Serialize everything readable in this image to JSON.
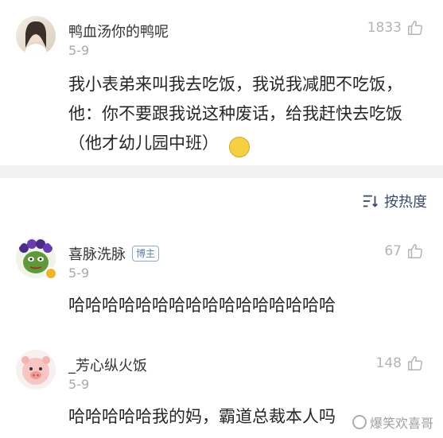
{
  "comments": [
    {
      "username": "鸭血汤你的鸭呢",
      "date": "5-9",
      "likes": "1833",
      "text": "我小表弟来叫我去吃饭，我说我减肥不吃饭，他：你不要跟我说这种废话，给我赶快去吃饭（他才幼儿园中班）",
      "emoji": "🙂"
    },
    {
      "username": "喜脉洗脉",
      "badge": "博主",
      "date": "5-9",
      "likes": "67",
      "text": "哈哈哈哈哈哈哈哈哈哈哈哈哈哈哈哈"
    },
    {
      "username": "_芳心纵火饭",
      "date": "5-9",
      "likes": "148",
      "text": "哈哈哈哈哈我的妈，霸道总裁本人吗"
    }
  ],
  "sort": {
    "label": "按热度"
  },
  "watermark": "爆笑欢喜哥",
  "colors": {
    "like": "#b4b4b4",
    "sort": "#3a4a6a",
    "badge": "#5b7fb3",
    "divider": "#f2f2f2"
  }
}
